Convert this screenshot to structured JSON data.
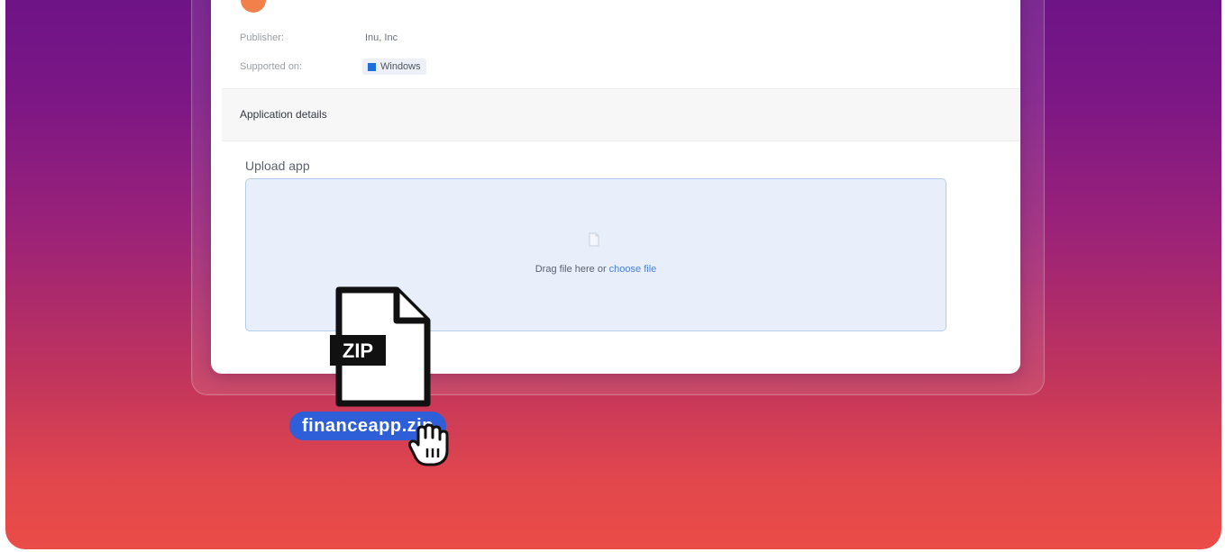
{
  "app": {
    "publisher_label": "Publisher:",
    "publisher_value": "Inu, Inc",
    "supported_label": "Supported on:",
    "platform": "Windows",
    "platform_icon": "windows-icon"
  },
  "section": {
    "title": "Application details"
  },
  "upload": {
    "label": "Upload app",
    "drop_text": "Drag file here or ",
    "choose_link": "choose file",
    "icon": "document-icon"
  },
  "dragged_file": {
    "type_badge": "ZIP",
    "filename": "financeapp.zip",
    "icon": "zip-file-icon",
    "cursor": "grab-hand-cursor-icon"
  },
  "colors": {
    "gradient_top": "#6e1487",
    "gradient_bottom": "#ea4c47",
    "link": "#4a7fd6",
    "chip": "#2f5fd8",
    "dropzone": "#e8effa"
  }
}
